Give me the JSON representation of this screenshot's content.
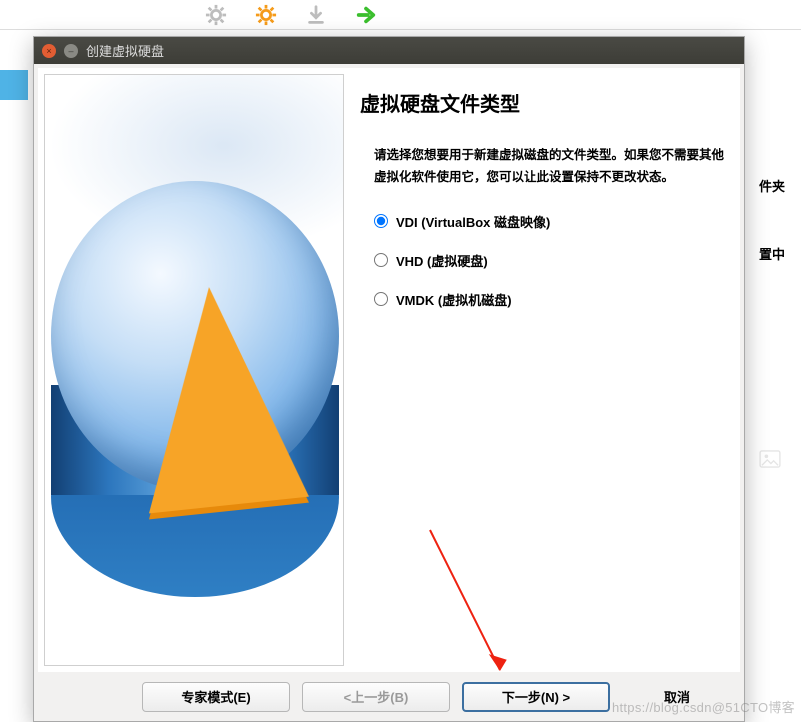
{
  "toolbar": {
    "icons": [
      "gear-gray-icon",
      "gear-orange-icon",
      "download-icon",
      "forward-icon"
    ]
  },
  "dialog": {
    "title": "创建虚拟硬盘",
    "heading": "虚拟硬盘文件类型",
    "description": "请选择您想要用于新建虚拟磁盘的文件类型。如果您不需要其他虚拟化软件使用它，您可以让此设置保持不更改状态。",
    "radios": [
      {
        "label": "VDI (VirtualBox 磁盘映像)",
        "selected": true
      },
      {
        "label": "VHD (虚拟硬盘)",
        "selected": false
      },
      {
        "label": "VMDK (虚拟机磁盘)",
        "selected": false
      }
    ],
    "buttons": {
      "expert": "专家模式(E)",
      "back": "<上一步(B)",
      "next": "下一步(N) >",
      "cancel": "取消"
    }
  },
  "background": {
    "fragment1": "件夹",
    "fragment2": "置中"
  },
  "watermark": "https://blog.csdn@51CTO博客"
}
